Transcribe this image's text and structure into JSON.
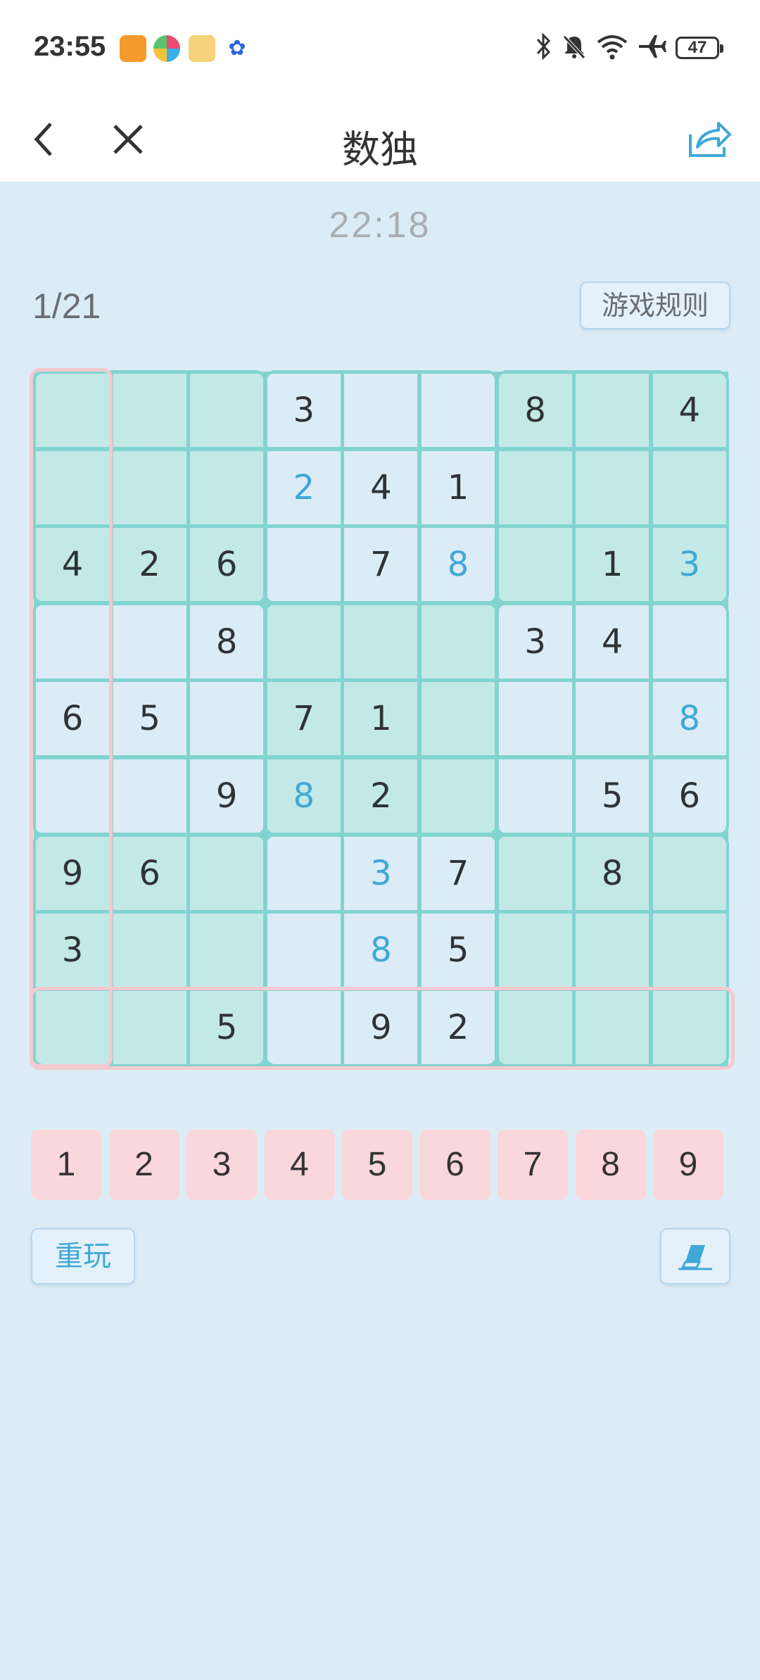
{
  "status_bar": {
    "time": "23:55",
    "battery": "47",
    "icons": [
      "bluetooth-icon",
      "mute-icon",
      "wifi-icon",
      "airplane-icon"
    ]
  },
  "header": {
    "title": "数独",
    "back_icon": "back-icon",
    "close_icon": "close-icon",
    "share_icon": "share-icon"
  },
  "game": {
    "timer": "22:18",
    "progress": "1/21",
    "rules_label": "游戏规则",
    "board": [
      [
        "",
        "",
        "",
        "3",
        "",
        "",
        "8",
        "",
        "4"
      ],
      [
        "",
        "",
        "",
        "2",
        "4",
        "1",
        "",
        "",
        ""
      ],
      [
        "4",
        "2",
        "6",
        "",
        "7",
        "8",
        "",
        "1",
        "3"
      ],
      [
        "",
        "",
        "8",
        "",
        "",
        "",
        "3",
        "4",
        ""
      ],
      [
        "6",
        "5",
        "",
        "7",
        "1",
        "",
        "",
        "",
        "8"
      ],
      [
        "",
        "",
        "9",
        "8",
        "2",
        "",
        "",
        "5",
        "6"
      ],
      [
        "9",
        "6",
        "",
        "",
        "3",
        "7",
        "",
        "8",
        ""
      ],
      [
        "3",
        "",
        "",
        "",
        "8",
        "5",
        "",
        "",
        ""
      ],
      [
        "",
        "",
        "5",
        "",
        "9",
        "2",
        "",
        "",
        ""
      ]
    ],
    "user_cells": [
      [
        1,
        3
      ],
      [
        2,
        5
      ],
      [
        2,
        8
      ],
      [
        4,
        8
      ],
      [
        5,
        3
      ],
      [
        6,
        4
      ],
      [
        7,
        4
      ]
    ],
    "selected": {
      "row": 8,
      "col": 0
    },
    "numpad": [
      "1",
      "2",
      "3",
      "4",
      "5",
      "6",
      "7",
      "8",
      "9"
    ],
    "replay_label": "重玩",
    "erase_icon": "eraser-icon"
  },
  "colors": {
    "background": "#dcecf6",
    "shaded_cell": "#c3e9e7",
    "grid_line": "#82d4d0",
    "highlight": "#f4c9cf",
    "user_digit": "#3fa8d8",
    "numpad_bg": "#f9d7da"
  }
}
